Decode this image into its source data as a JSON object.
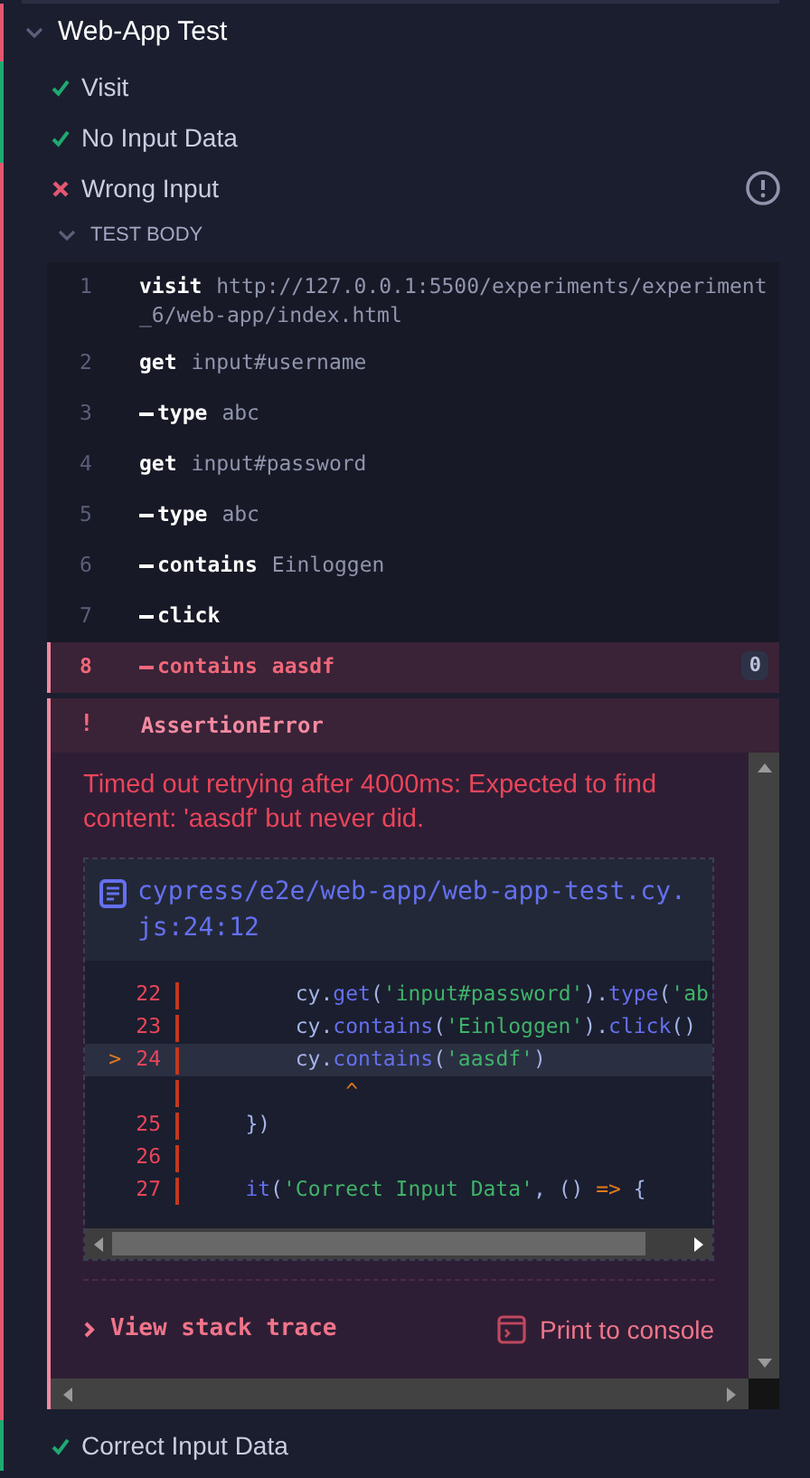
{
  "suite": {
    "title": "Web-App Test",
    "failed": true,
    "expanded": true
  },
  "tests": [
    {
      "title": "Visit",
      "passed": true,
      "expanded": false
    },
    {
      "title": "No Input Data",
      "passed": true,
      "expanded": false
    },
    {
      "title": "Wrong Input",
      "passed": false,
      "expanded": true,
      "section": {
        "title": "TEST BODY",
        "expanded": true
      },
      "commands": [
        {
          "number": "1",
          "kind": "parent",
          "name": "visit",
          "message": "http://127.0.0.1:5500/experiments/experiment_6/web-app/index.html",
          "failed": false
        },
        {
          "number": "2",
          "kind": "parent",
          "name": "get",
          "message": "input#username",
          "failed": false
        },
        {
          "number": "3",
          "kind": "child",
          "name": "type",
          "message": "abc",
          "failed": false
        },
        {
          "number": "4",
          "kind": "parent",
          "name": "get",
          "message": "input#password",
          "failed": false
        },
        {
          "number": "5",
          "kind": "child",
          "name": "type",
          "message": "abc",
          "failed": false
        },
        {
          "number": "6",
          "kind": "child",
          "name": "contains",
          "message": "Einloggen",
          "failed": false
        },
        {
          "number": "7",
          "kind": "child",
          "name": "click",
          "failed": false
        },
        {
          "number": "8",
          "kind": "child",
          "name": "contains",
          "message": "aasdf",
          "failed": true,
          "count": "0"
        }
      ],
      "error": {
        "mark": "!",
        "name": "AssertionError",
        "message": "Timed out retrying after 4000ms: Expected to find content: 'aasdf' but never did.",
        "file": "cypress/e2e/web-app/web-app-test.cy.js:24:12",
        "code_lines": [
          {
            "number": "22",
            "selected": false,
            "tokens": [
              {
                "kind": "plain",
                "text": "        cy."
              },
              {
                "kind": "fn",
                "text": "get"
              },
              {
                "kind": "plain",
                "text": "("
              },
              {
                "kind": "str",
                "text": "'input#password'"
              },
              {
                "kind": "plain",
                "text": ")."
              },
              {
                "kind": "fn",
                "text": "type"
              },
              {
                "kind": "plain",
                "text": "("
              },
              {
                "kind": "str",
                "text": "'ab"
              }
            ]
          },
          {
            "number": "23",
            "selected": false,
            "tokens": [
              {
                "kind": "plain",
                "text": "        cy."
              },
              {
                "kind": "fn",
                "text": "contains"
              },
              {
                "kind": "plain",
                "text": "("
              },
              {
                "kind": "str",
                "text": "'Einloggen'"
              },
              {
                "kind": "plain",
                "text": ")."
              },
              {
                "kind": "fn",
                "text": "click"
              },
              {
                "kind": "plain",
                "text": "()"
              }
            ]
          },
          {
            "number": "24",
            "selected": true,
            "marker": ">",
            "tokens": [
              {
                "kind": "plain",
                "text": "        cy."
              },
              {
                "kind": "fn",
                "text": "contains"
              },
              {
                "kind": "plain",
                "text": "("
              },
              {
                "kind": "str",
                "text": "'aasdf'"
              },
              {
                "kind": "plain",
                "text": ")"
              }
            ]
          },
          {
            "selected": false,
            "tokens": [
              {
                "kind": "op",
                "text": "            ^"
              }
            ]
          },
          {
            "number": "25",
            "selected": false,
            "tokens": [
              {
                "kind": "plain",
                "text": "    })"
              }
            ]
          },
          {
            "number": "26",
            "selected": false
          },
          {
            "number": "27",
            "selected": false,
            "tokens": [
              {
                "kind": "fn",
                "text": "    it"
              },
              {
                "kind": "plain",
                "text": "("
              },
              {
                "kind": "str",
                "text": "'Correct Input Data'"
              },
              {
                "kind": "plain",
                "text": ", () "
              },
              {
                "kind": "op",
                "text": "=>"
              },
              {
                "kind": "plain",
                "text": " {"
              }
            ]
          }
        ],
        "actions": [
          {
            "kind": "stack",
            "label": "View stack trace"
          },
          {
            "kind": "console",
            "label": "Print to console"
          }
        ]
      }
    },
    {
      "title": "Correct Input Data",
      "passed": true,
      "expanded": false
    }
  ]
}
